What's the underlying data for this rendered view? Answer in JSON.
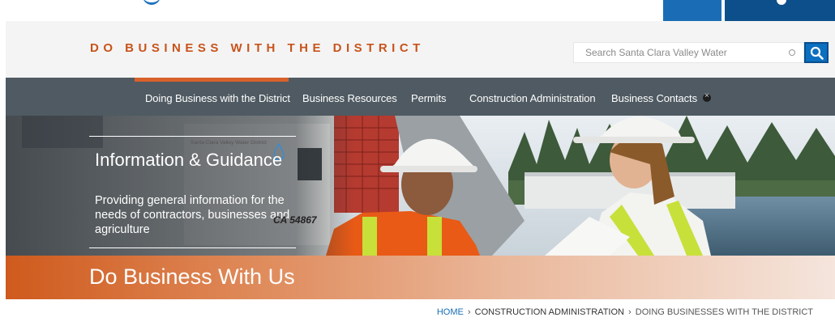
{
  "header": {
    "site_title": "DO BUSINESS WITH THE DISTRICT",
    "search_placeholder": "Search Santa Clara Valley Water"
  },
  "nav": {
    "items": [
      {
        "label": "Doing Business with the District",
        "active": true
      },
      {
        "label": "Business Resources"
      },
      {
        "label": "Permits"
      },
      {
        "label": "Construction Administration"
      },
      {
        "label": "Business Contacts"
      }
    ]
  },
  "hero": {
    "title": "Information & Guidance",
    "description": "Providing general information for the needs of contractors, businesses and agriculture",
    "truck_text": "Santa Clara Valley Water District",
    "plate": "CA 54867"
  },
  "banner": {
    "title": "Do Business With Us"
  },
  "breadcrumb": {
    "home": "HOME",
    "sep1": "›",
    "section": "CONSTRUCTION ADMINISTRATION",
    "sep2": "›",
    "current": "DOING BUSINESSES WITH THE DISTRICT"
  },
  "colors": {
    "accent": "#c8541b",
    "nav_bg": "#4f5a62",
    "link_blue": "#1a6db5"
  },
  "icons": {
    "search": "search-icon",
    "close": "close-icon"
  }
}
